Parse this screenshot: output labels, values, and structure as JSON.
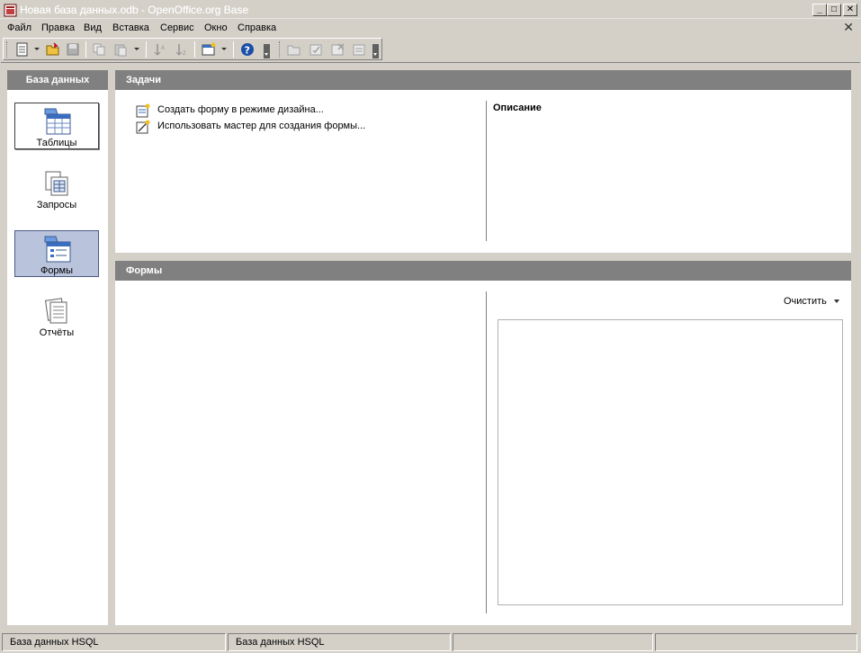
{
  "window": {
    "title": "Новая база данных.odb - OpenOffice.org Base",
    "minimize_label": "_",
    "maximize_label": "□",
    "close_label": "✕",
    "doc_close_label": "✕"
  },
  "menubar": {
    "items": [
      "Файл",
      "Правка",
      "Вид",
      "Вставка",
      "Сервис",
      "Окно",
      "Справка"
    ]
  },
  "toolbar": {
    "icons": [
      "new-document-icon",
      "open-folder-icon",
      "save-icon",
      "copy-icon",
      "paste-icon",
      "sort-ascending-icon",
      "sort-descending-icon",
      "form-icon",
      "help-icon",
      "open-object-icon",
      "edit-object-icon",
      "delete-object-icon",
      "rename-object-icon"
    ]
  },
  "sidebar": {
    "header": "База данных",
    "items": [
      {
        "label": "Таблицы",
        "icon": "tables-icon",
        "state": "hover"
      },
      {
        "label": "Запросы",
        "icon": "queries-icon",
        "state": "normal"
      },
      {
        "label": "Формы",
        "icon": "forms-icon",
        "state": "selected"
      },
      {
        "label": "Отчёты",
        "icon": "reports-icon",
        "state": "normal"
      }
    ]
  },
  "tasks": {
    "header": "Задачи",
    "items": [
      {
        "label": "Создать форму в режиме дизайна...",
        "icon": "form-design-icon"
      },
      {
        "label": "Использовать мастер для создания формы...",
        "icon": "form-wizard-icon"
      }
    ],
    "description_title": "Описание"
  },
  "forms": {
    "header": "Формы",
    "clear_label": "Очистить"
  },
  "statusbar": {
    "fields": [
      "База данных HSQL",
      "База данных HSQL",
      "",
      "",
      ""
    ]
  },
  "colors": {
    "panel_header": "#808080",
    "background": "#d4d0c8",
    "selection": "#b9c4dc",
    "help_blue": "#1a4fa8"
  }
}
